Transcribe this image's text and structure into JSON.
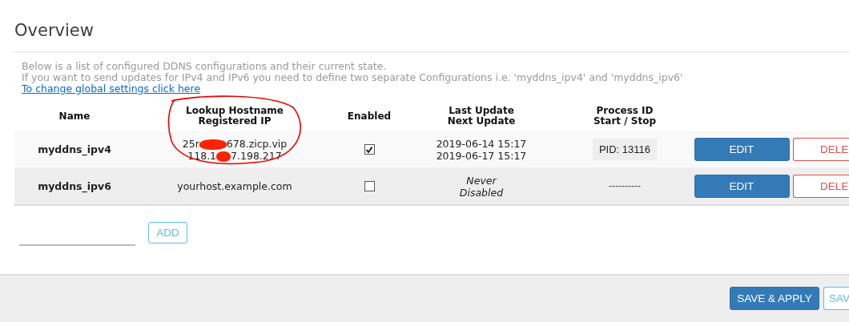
{
  "title": "Overview",
  "description": [
    "Below is a list of configured DDNS configurations and their current state.",
    "If you want to send updates for IPv4 and IPv6 you need to define two separate Configurations i.e. 'myddns_ipv4' and 'myddns_ipv6'"
  ],
  "global_settings_link": "To change global settings click here",
  "table": {
    "columns": [
      [
        "Name"
      ],
      [
        "Lookup Hostname",
        "Registered IP"
      ],
      [
        "Enabled"
      ],
      [
        "Last Update",
        "Next Update"
      ],
      [
        "Process ID",
        "Start / Stop"
      ]
    ],
    "rows": [
      {
        "name": "myddns_ipv4",
        "kind": "redacted",
        "hostname": [
          "25r",
          "678.zicp.vip"
        ],
        "ip": [
          "118.1",
          "7.198.217"
        ],
        "enabled": true,
        "update": [
          "2019-06-14 15:17",
          "2019-06-17 15:17"
        ],
        "update_italic": false,
        "process": {
          "kind": "pid",
          "text": "PID: 13116"
        },
        "edit": "EDIT",
        "delete": "DELE"
      },
      {
        "name": "myddns_ipv6",
        "kind": "plain",
        "hostname": [
          "yourhost.example.com"
        ],
        "enabled": false,
        "update": [
          "Never",
          "Disabled"
        ],
        "update_italic": true,
        "process": {
          "kind": "none",
          "text": "----------"
        },
        "edit": "EDIT",
        "delete": "DELE"
      }
    ]
  },
  "add_button": "ADD",
  "footer_buttons": [
    {
      "label": "SAVE & APPLY",
      "kind": "primary"
    },
    {
      "label": "SAV",
      "kind": "outline"
    }
  ]
}
